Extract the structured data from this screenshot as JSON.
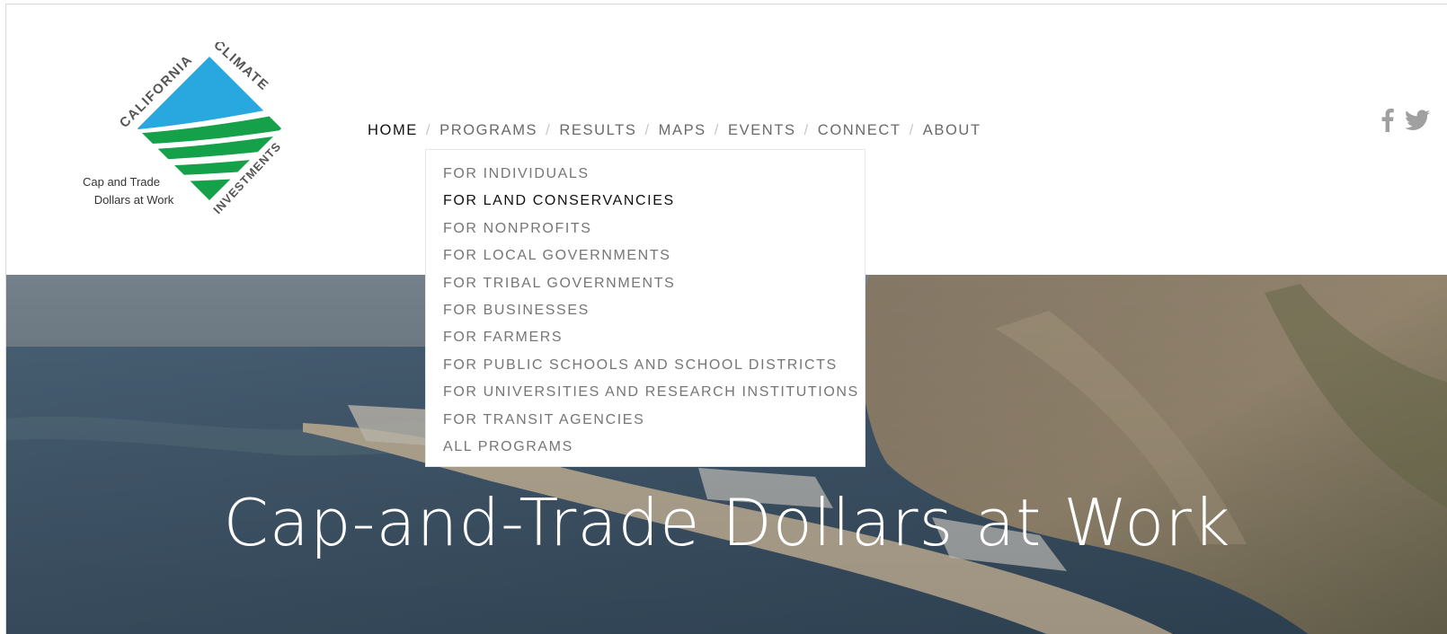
{
  "logo": {
    "arc_text_left": "CALIFORNIA",
    "arc_text_right": "CLIMATE",
    "arc_text_bottom": "INVESTMENTS",
    "tagline_line1": "Cap and Trade",
    "tagline_line2": "Dollars at Work",
    "colors": {
      "blue": "#29a8e0",
      "green": "#15a04a"
    }
  },
  "nav": {
    "items": [
      {
        "label": "HOME",
        "active": true
      },
      {
        "label": "PROGRAMS",
        "active": false
      },
      {
        "label": "RESULTS",
        "active": false
      },
      {
        "label": "MAPS",
        "active": false
      },
      {
        "label": "EVENTS",
        "active": false
      },
      {
        "label": "CONNECT",
        "active": false
      },
      {
        "label": "ABOUT",
        "active": false
      }
    ],
    "separator": "/"
  },
  "programs_menu": {
    "items": [
      "FOR INDIVIDUALS",
      "FOR LAND CONSERVANCIES",
      "FOR NONPROFITS",
      "FOR LOCAL GOVERNMENTS",
      "FOR TRIBAL GOVERNMENTS",
      "FOR BUSINESSES",
      "FOR FARMERS",
      "FOR PUBLIC SCHOOLS AND SCHOOL DISTRICTS",
      "FOR UNIVERSITIES AND RESEARCH INSTITUTIONS",
      "FOR TRANSIT AGENCIES",
      "ALL PROGRAMS"
    ],
    "hovered_index": 1
  },
  "social": {
    "icons": [
      "facebook-icon",
      "twitter-icon"
    ],
    "color": "#a0a0a0"
  },
  "hero": {
    "title": "Cap-and-Trade Dollars at Work"
  }
}
